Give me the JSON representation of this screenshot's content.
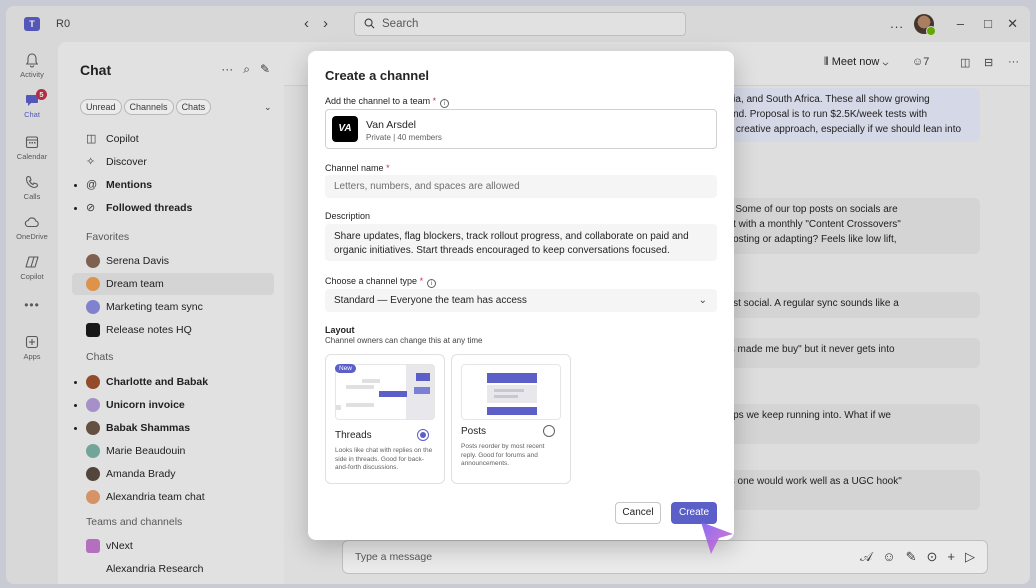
{
  "titlebar": {
    "workspace": "R0",
    "search_placeholder": "Search",
    "more": "...",
    "minimize": "–",
    "maximize": "□",
    "close": "✕"
  },
  "rail": [
    {
      "label": "Activity",
      "icon": "bell-icon"
    },
    {
      "label": "Chat",
      "icon": "chat-icon",
      "badge": "5"
    },
    {
      "label": "Calendar",
      "icon": "calendar-icon"
    },
    {
      "label": "Calls",
      "icon": "phone-icon"
    },
    {
      "label": "OneDrive",
      "icon": "cloud-icon"
    },
    {
      "label": "Copilot",
      "icon": "copilot-icon"
    },
    {
      "label": "Apps",
      "icon": "add-app-icon"
    }
  ],
  "list": {
    "title": "Chat",
    "filters": [
      "Unread",
      "Channels",
      "Chats"
    ],
    "copilot": "Copilot",
    "discover": "Discover",
    "mentions": "Mentions",
    "followed": "Followed threads",
    "favorites_header": "Favorites",
    "favorites": [
      "Serena Davis",
      "Dream team",
      "Marketing team sync",
      "Release notes HQ"
    ],
    "chats_header": "Chats",
    "chats": [
      "Charlotte and Babak",
      "Unicorn invoice",
      "Babak Shammas",
      "Marie Beaudouin",
      "Amanda Brady",
      "Alexandria team chat"
    ],
    "teams_header": "Teams and channels",
    "teams": [
      "vNext",
      "Alexandria Research"
    ]
  },
  "conversation": {
    "meet_now": "Meet now",
    "people_count": "7",
    "messages": [
      "ralia, and South Africa. These all show growing",
      "pend. Proposal is to run $2.5K/week tests with",
      "nd creative approach, especially if we should lean into",
      "id. Some of our top posts on socials are",
      "ent with a monthly \"Content Crossovers\"",
      "boosting or adapting? Feels like low lift,",
      "past social. A regular sync sounds like a",
      "his made me buy\" but it never gets into",
      "gaps we keep running into. What if we",
      "his one would work well as a UGC hook\""
    ],
    "compose_placeholder": "Type a message"
  },
  "dialog": {
    "title": "Create a channel",
    "team_label": "Add the channel to a team",
    "team_name": "Van Arsdel",
    "team_logo": "VA",
    "team_meta": "Private | 40 members",
    "name_label": "Channel name",
    "name_placeholder": "Letters, numbers, and spaces are allowed",
    "desc_label": "Description",
    "desc_value": "Share updates, flag blockers, track rollout progress, and collaborate on paid and organic initiatives. Start threads encouraged to keep conversations focused.",
    "type_label": "Choose a channel type",
    "type_value": "Standard — Everyone the team has access",
    "layout_title": "Layout",
    "layout_subtitle": "Channel owners can change this at any time",
    "threads_badge": "New",
    "threads_name": "Threads",
    "threads_desc": "Looks like chat with replies on the side in threads. Good for back-and-forth discussions.",
    "posts_name": "Posts",
    "posts_desc": "Posts reorder by most recent reply. Good for forums and announcements.",
    "selected_layout": "Threads",
    "cancel": "Cancel",
    "create": "Create",
    "required_mark": "*",
    "info_mark": "i"
  },
  "colors": {
    "accent": "#5b5fc7",
    "badge": "#c4314b"
  }
}
